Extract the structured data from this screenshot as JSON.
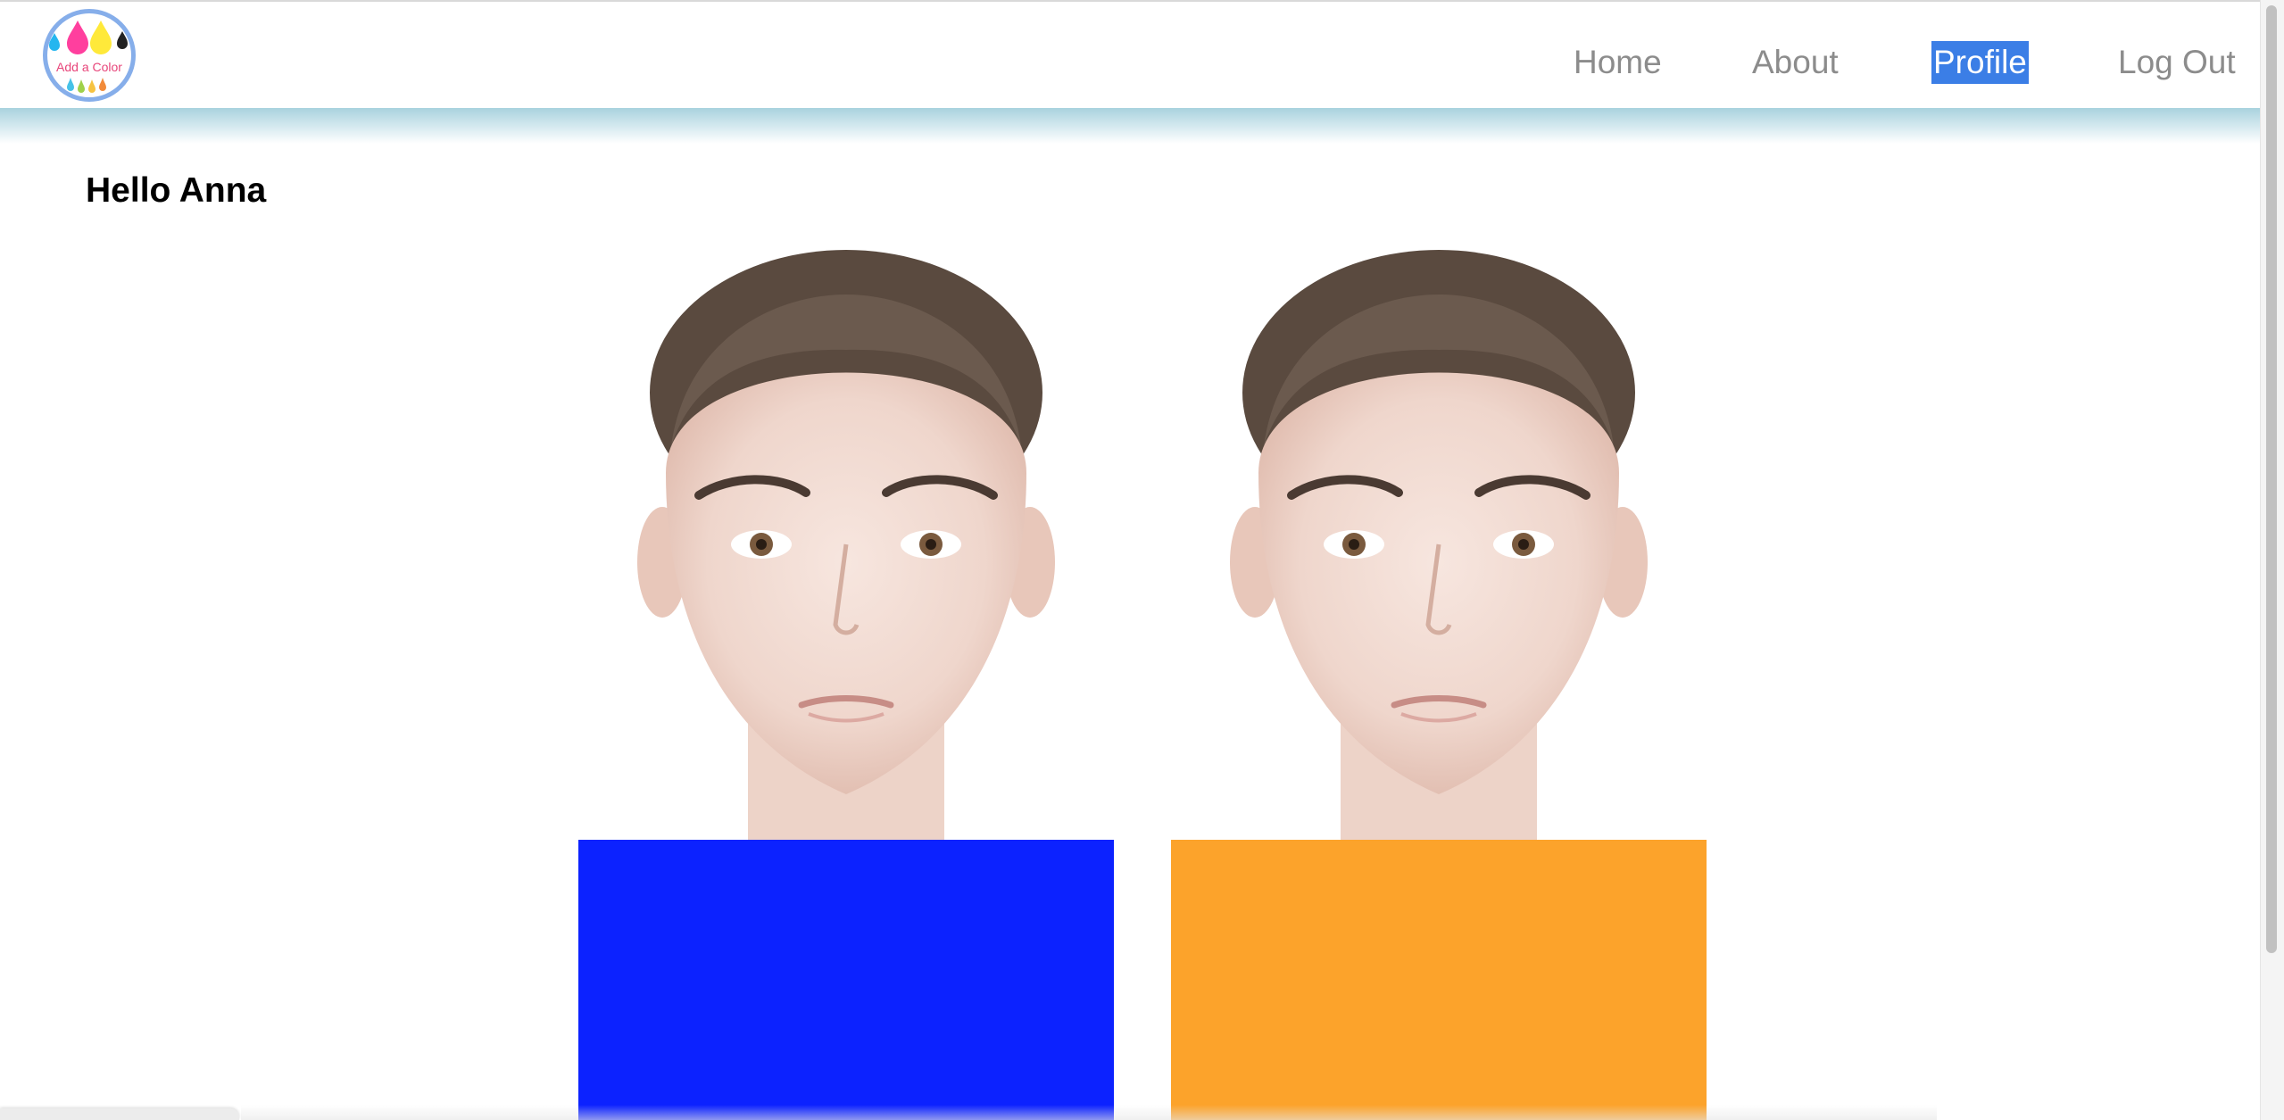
{
  "logo": {
    "text": "Add a Color"
  },
  "nav": {
    "items": [
      {
        "label": "Home"
      },
      {
        "label": "About"
      },
      {
        "label": "Profile",
        "active": true
      },
      {
        "label": "Log Out"
      }
    ]
  },
  "main": {
    "greeting": "Hello Anna",
    "swatches": [
      {
        "color": "#0c22ff"
      },
      {
        "color": "#fca32b"
      }
    ]
  },
  "colors": {
    "active_highlight": "#3b7ee6",
    "nav_text": "#8c8c8c",
    "header_shadow": "#a9d2de"
  }
}
